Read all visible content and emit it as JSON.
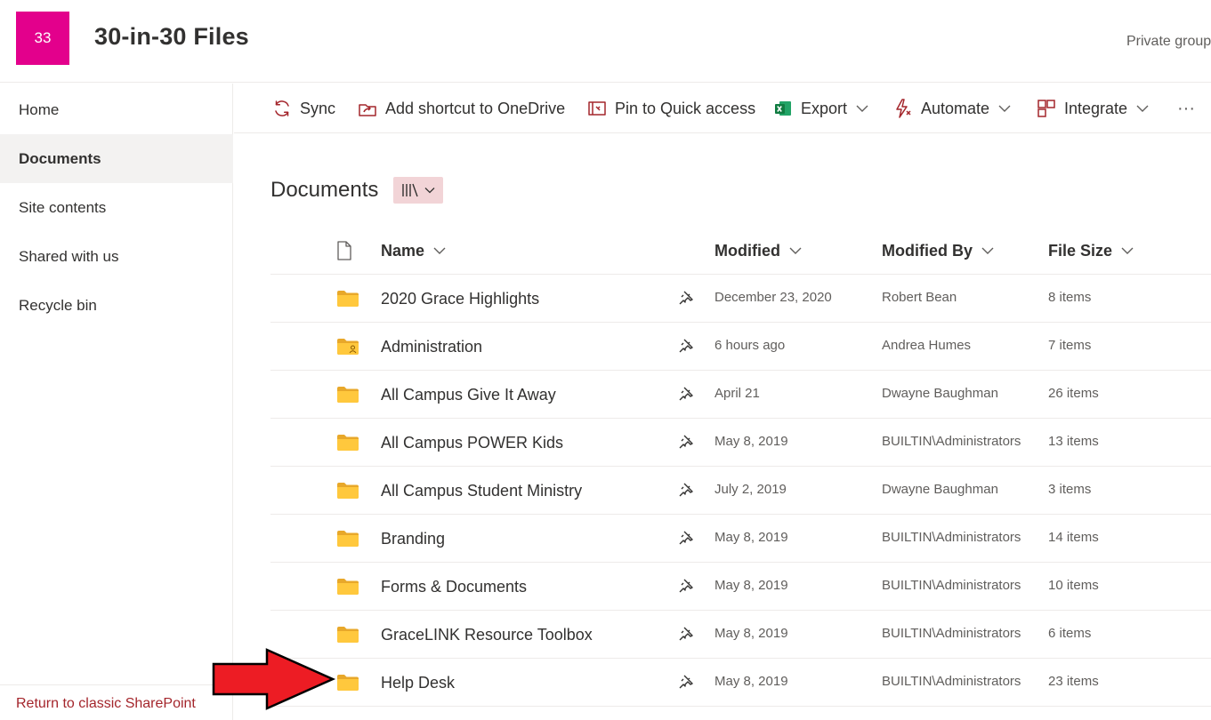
{
  "header": {
    "logo_text": "33",
    "logo_color": "#e3008c",
    "site_title": "30-in-30 Files",
    "privacy_label": "Private group"
  },
  "nav": {
    "items": [
      {
        "label": "Home",
        "active": false
      },
      {
        "label": "Documents",
        "active": true
      },
      {
        "label": "Site contents",
        "active": false
      },
      {
        "label": "Shared with us",
        "active": false
      },
      {
        "label": "Recycle bin",
        "active": false
      }
    ],
    "footer_link": "Return to classic SharePoint"
  },
  "commands": {
    "sync": "Sync",
    "add_shortcut": "Add shortcut to OneDrive",
    "pin_quick_access": "Pin to Quick access",
    "export": "Export",
    "automate": "Automate",
    "integrate": "Integrate",
    "more": "···"
  },
  "library": {
    "title": "Documents",
    "columns": {
      "name": "Name",
      "modified": "Modified",
      "modified_by": "Modified By",
      "file_size": "File Size"
    },
    "rows": [
      {
        "name": "2020 Grace Highlights",
        "modified": "December 23, 2020",
        "modified_by": "Robert Bean",
        "size": "8 items",
        "shared": false
      },
      {
        "name": "Administration",
        "modified": "6 hours ago",
        "modified_by": "Andrea Humes",
        "size": "7 items",
        "shared": true
      },
      {
        "name": "All Campus Give It Away",
        "modified": "April 21",
        "modified_by": "Dwayne Baughman",
        "size": "26 items",
        "shared": false
      },
      {
        "name": "All Campus POWER Kids",
        "modified": "May 8, 2019",
        "modified_by": "BUILTIN\\Administrators",
        "size": "13 items",
        "shared": false
      },
      {
        "name": "All Campus Student Ministry",
        "modified": "July 2, 2019",
        "modified_by": "Dwayne Baughman",
        "size": "3 items",
        "shared": false
      },
      {
        "name": "Branding",
        "modified": "May 8, 2019",
        "modified_by": "BUILTIN\\Administrators",
        "size": "14 items",
        "shared": false
      },
      {
        "name": "Forms & Documents",
        "modified": "May 8, 2019",
        "modified_by": "BUILTIN\\Administrators",
        "size": "10 items",
        "shared": false
      },
      {
        "name": "GraceLINK Resource Toolbox",
        "modified": "May 8, 2019",
        "modified_by": "BUILTIN\\Administrators",
        "size": "6 items",
        "shared": false
      },
      {
        "name": "Help Desk",
        "modified": "May 8, 2019",
        "modified_by": "BUILTIN\\Administrators",
        "size": "23 items",
        "shared": false
      }
    ]
  },
  "colors": {
    "folder": "#ffc83d",
    "folder_dark": "#e8a82a",
    "footer_link": "#a4262c",
    "annotation_arrow": "#ed1c24"
  },
  "icons": {
    "sync": "sync-icon",
    "shortcut": "add-shortcut-icon",
    "pin": "pin-icon",
    "export": "excel-icon",
    "automate": "automate-icon",
    "integrate": "integrate-icon",
    "file_type": "file-type-icon",
    "folder": "folder-icon",
    "pin_column": "pin-column-icon",
    "annotation": "red-arrow-icon"
  }
}
